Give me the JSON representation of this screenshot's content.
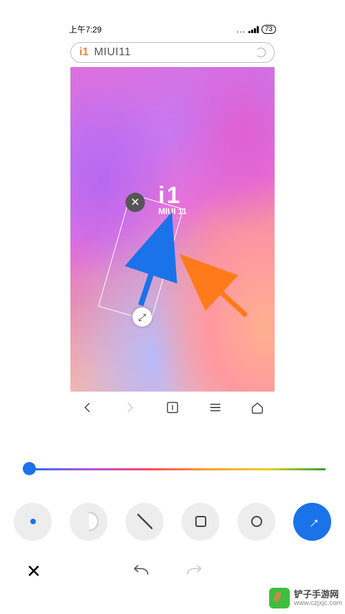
{
  "preview": {
    "status_bar": {
      "time": "上午7:29",
      "battery": "73"
    },
    "search": {
      "logo": "i1",
      "text": "MIUI11"
    },
    "center_logo": {
      "big1": "i",
      "big2": "1",
      "row1": "MIUI 11",
      "row2": "· · · · ·"
    },
    "selection": {
      "delete_label": "✕",
      "resize_label": "⤢"
    }
  },
  "slider": {
    "value_pct": 2
  },
  "tools": {
    "dot": {
      "name": "brush-dot",
      "active": true
    },
    "half": {
      "name": "brush-soft"
    },
    "line": {
      "name": "shape-line"
    },
    "rect": {
      "name": "shape-rect"
    },
    "circle": {
      "name": "shape-circle"
    },
    "share": {
      "name": "share",
      "glyph": "→"
    }
  },
  "actions": {
    "close": "✕"
  },
  "watermark": {
    "name": "铲子手游网",
    "url": "www.czjxjc.com"
  }
}
